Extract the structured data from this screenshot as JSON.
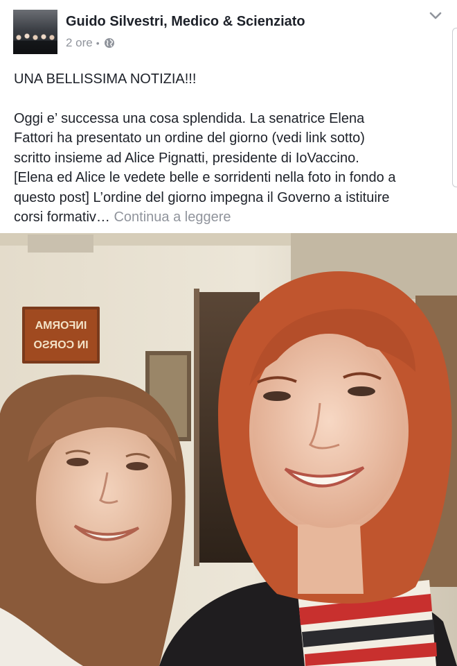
{
  "post": {
    "author": "Guido Silvestri, Medico & Scienziato",
    "time": "2 ore",
    "separator": "•",
    "audience_icon": "globe-icon",
    "menu_icon": "chevron-down-icon",
    "headline": "UNA BELLISSIMA NOTIZIA!!!",
    "body_lines": [
      "Oggi e’ successa una cosa splendida. La senatrice Elena",
      "Fattori ha presentato un ordine del giorno (vedi link sotto)",
      "scritto insieme ad Alice Pignatti, presidente di IoVaccino.",
      "[Elena ed Alice le vedete belle e sorridenti nella foto in fondo a",
      "questo post] L’ordine del giorno impegna il Governo a istituire"
    ],
    "truncated_line": "corsi formativ…",
    "see_more": "Continua a leggere"
  },
  "photo": {
    "sign_text_top": "INFORMA",
    "sign_text_bottom": "IN CORSO"
  },
  "colors": {
    "text": "#1d2129",
    "muted": "#90949c",
    "wall": "#e9e3d4",
    "hair": "#c0552e"
  }
}
